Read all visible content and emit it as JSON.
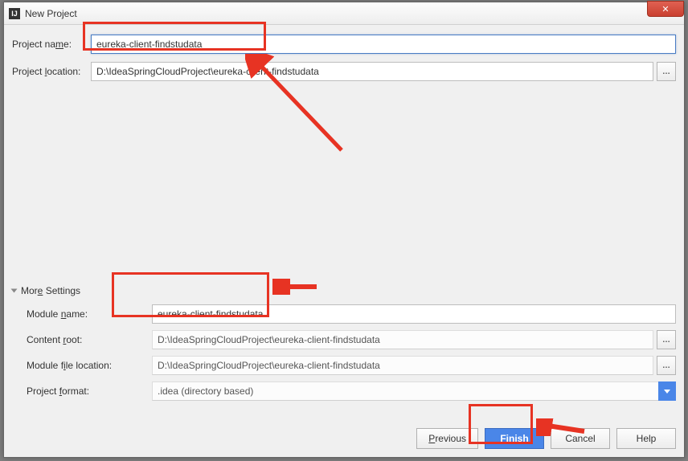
{
  "window": {
    "title": "New Project",
    "icon_text": "IJ"
  },
  "form": {
    "project_name_label": "Project name:",
    "project_name_value": "eureka-client-findstudata",
    "project_location_label": "Project location:",
    "project_location_value": "D:\\IdeaSpringCloudProject\\eureka-client-findstudata"
  },
  "more_settings_label": "More Settings",
  "settings": {
    "module_name_label": "Module name:",
    "module_name_value": "eureka-client-findstudata",
    "content_root_label": "Content root:",
    "content_root_value": "D:\\IdeaSpringCloudProject\\eureka-client-findstudata",
    "module_file_loc_label": "Module file location:",
    "module_file_loc_value": "D:\\IdeaSpringCloudProject\\eureka-client-findstudata",
    "project_format_label": "Project format:",
    "project_format_value": ".idea (directory based)"
  },
  "buttons": {
    "previous": "Previous",
    "finish": "Finish",
    "cancel": "Cancel",
    "help": "Help"
  }
}
